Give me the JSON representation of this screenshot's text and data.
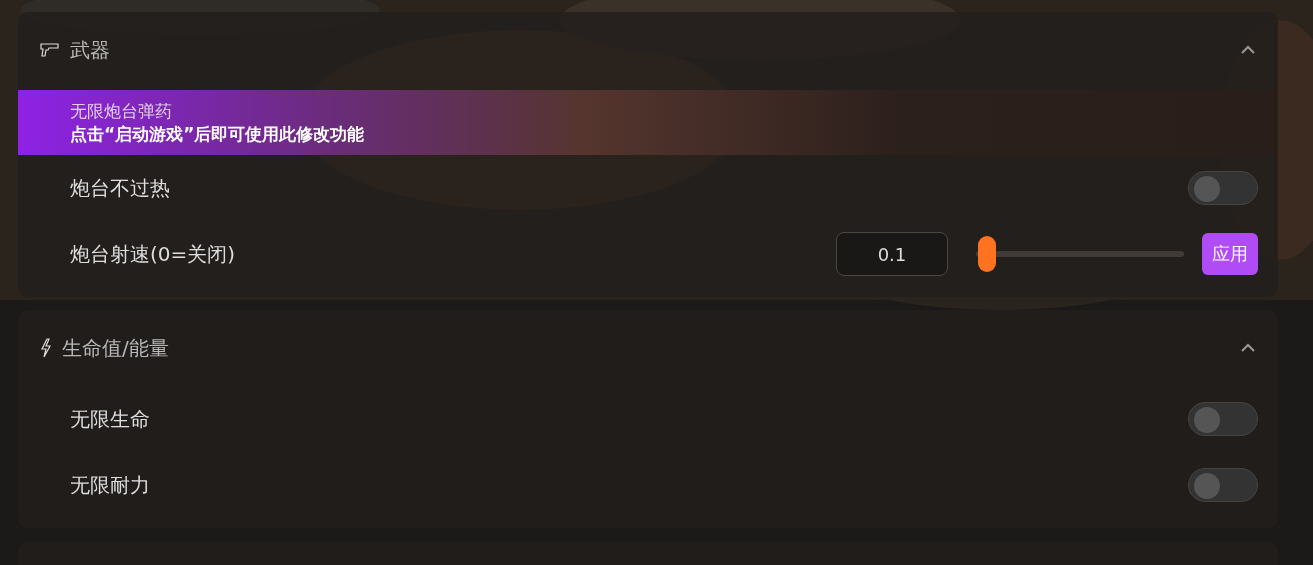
{
  "sections": [
    {
      "title": "武器",
      "expanded": true,
      "items": [
        {
          "kind": "notice",
          "label": "无限炮台弹药",
          "message": "点击“启动游戏”后即可使用此修改功能"
        },
        {
          "kind": "toggle",
          "label": "炮台不过热",
          "on": false
        },
        {
          "kind": "slider",
          "label": "炮台射速(0=关闭)",
          "value": "0.1",
          "level": 0.01,
          "button": "应用"
        }
      ]
    },
    {
      "title": "生命值/能量",
      "expanded": true,
      "items": [
        {
          "kind": "toggle",
          "label": "无限生命",
          "on": false
        },
        {
          "kind": "toggle",
          "label": "无限耐力",
          "on": false
        }
      ]
    },
    {
      "cut": true
    }
  ]
}
